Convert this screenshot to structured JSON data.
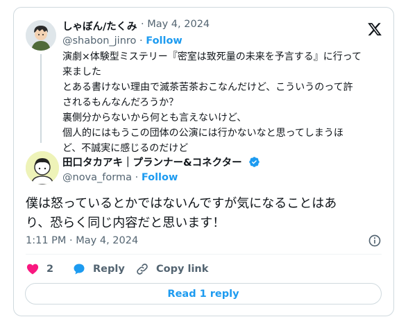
{
  "quoted_tweet": {
    "author_name": "しゃぼん/たくみ",
    "date": "· May 4, 2024",
    "handle": "@shabon_jinro",
    "separator": "·",
    "follow_label": "Follow",
    "lines": [
      "演劇×体験型ミステリー『密室は致死量の未来を予言する』に行って",
      "来ました",
      "とある書けない理由で滅茶苦茶おこなんだけど、こういうのって許",
      "されるもんなんだろうか？",
      "裏側分からないから何とも言えないけど、",
      "個人的にはもうこの団体の公演には行かないなと思ってしまうほ",
      "ど、不誠実に感じるのだけど"
    ]
  },
  "reply_tweet": {
    "author_name": "田口タカアキ｜プランナー&コネクター",
    "handle": "@nova_forma",
    "separator": "·",
    "follow_label": "Follow",
    "text_lines": [
      "僕は怒っているとかではないんですが気になることはあ",
      "り、恐らく同じ内容だと思います！"
    ],
    "timestamp": "1:11 PM · May 4, 2024"
  },
  "actions": {
    "like_count": "2",
    "reply_label": "Reply",
    "copy_link_label": "Copy link"
  },
  "read_replies_label": "Read 1 reply",
  "colors": {
    "accent": "#1d9bf0",
    "like": "#f91880",
    "muted": "#536471",
    "border": "#cfd9de"
  },
  "icons": [
    "x-logo-icon",
    "verified-badge-icon",
    "info-icon",
    "heart-icon",
    "reply-bubble-icon",
    "link-icon"
  ]
}
